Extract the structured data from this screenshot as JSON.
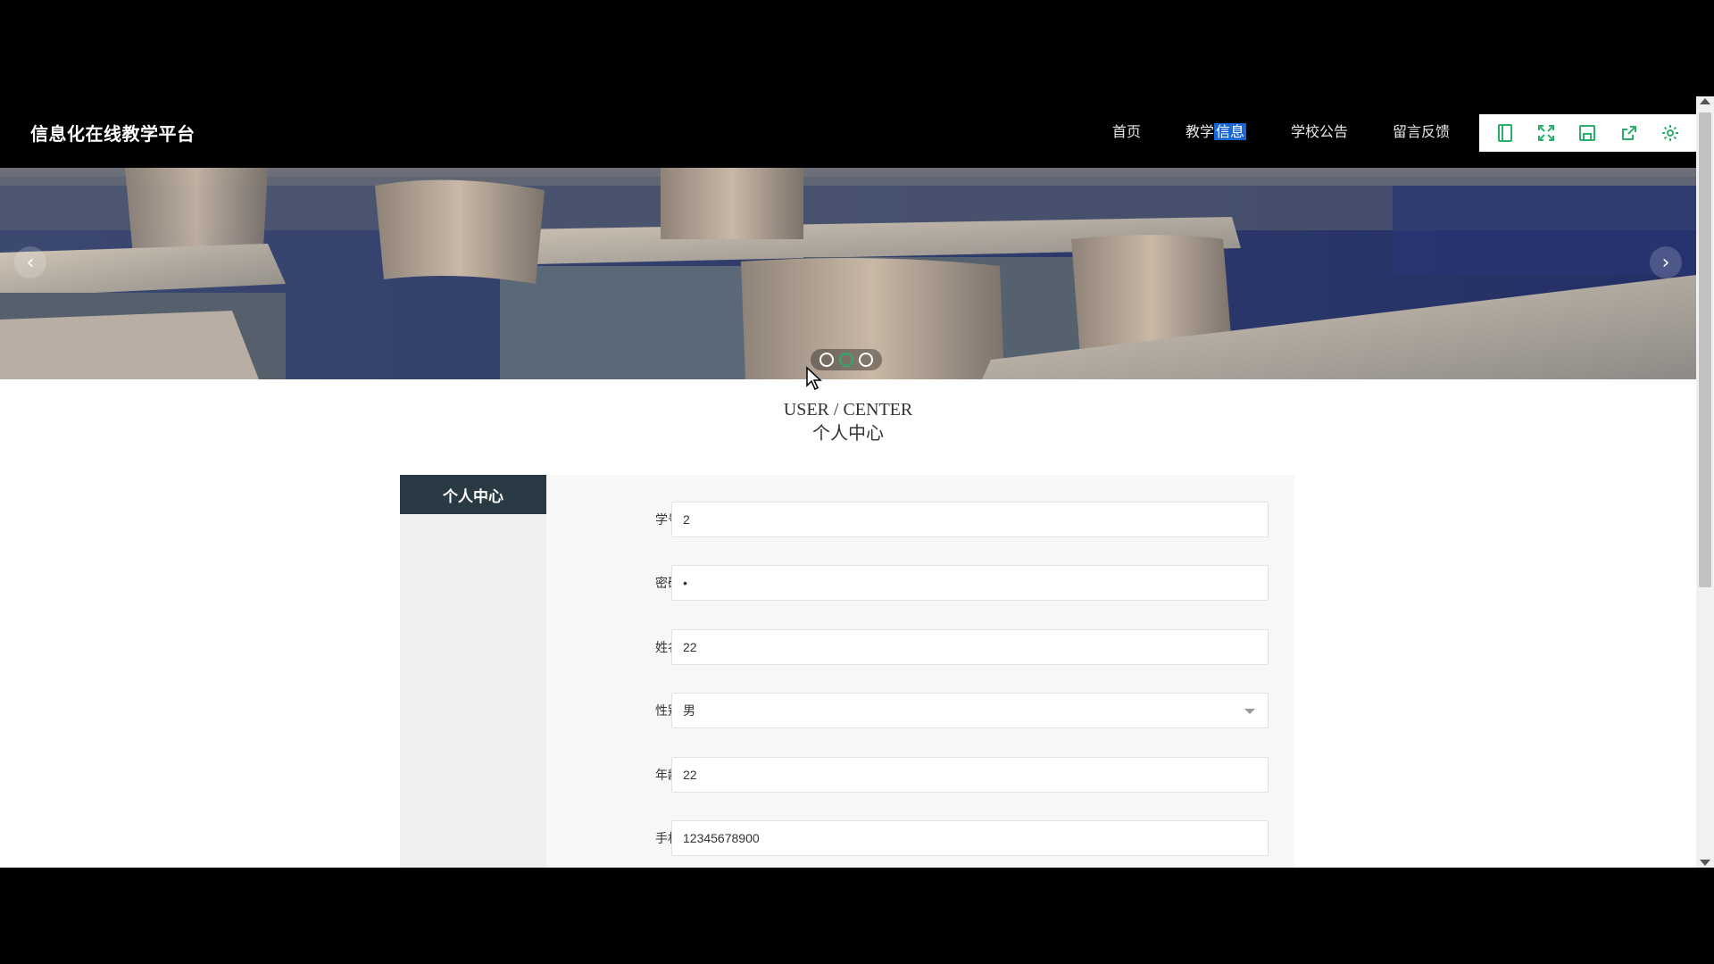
{
  "header": {
    "brand": "信息化在线教学平台",
    "nav": [
      {
        "label": "首页"
      },
      {
        "label_a": "教学",
        "label_b": "信息"
      },
      {
        "label": "学校公告"
      },
      {
        "label": "留言反馈"
      }
    ]
  },
  "toolbar": {
    "icons": [
      "bookmark-icon",
      "fullscreen-icon",
      "save-icon",
      "share-icon",
      "gear-icon"
    ],
    "accent": "#2cae6b"
  },
  "banner": {
    "arrow_left": "‹",
    "arrow_right": "›",
    "dot_count": 3,
    "active_dot": 1
  },
  "section": {
    "title_en": "USER / CENTER",
    "title_cn": "个人中心"
  },
  "sidebar": {
    "heading": "个人中心"
  },
  "form": {
    "student_id": {
      "label": "学号",
      "value": "2"
    },
    "password": {
      "label": "密码",
      "value": "•"
    },
    "name": {
      "label": "姓名",
      "value": "22"
    },
    "gender": {
      "label": "性别",
      "value": "男"
    },
    "age": {
      "label": "年龄",
      "value": "22"
    },
    "phone": {
      "label": "手机",
      "value": "12345678900"
    }
  },
  "colors": {
    "nav_highlight": "#1a66d6",
    "sidebar_head": "#2a3a44",
    "active_dot": "#2cae6b"
  }
}
